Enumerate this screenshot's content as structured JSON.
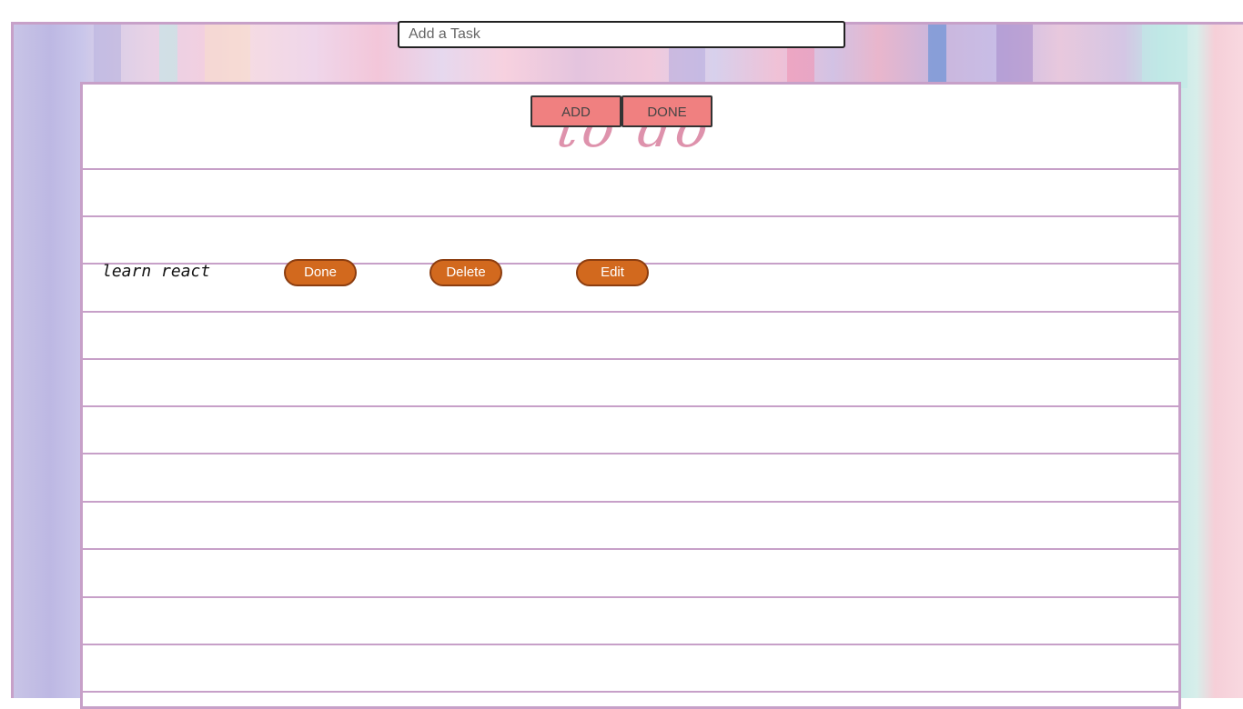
{
  "task_input": {
    "placeholder": "Add a Task",
    "value": ""
  },
  "toolbar": {
    "add_label": "ADD",
    "done_label": "DONE"
  },
  "title": "to do",
  "tasks": [
    {
      "text": "learn react",
      "done_label": "Done",
      "delete_label": "Delete",
      "edit_label": "Edit"
    }
  ],
  "colors": {
    "top_button": "#f08080",
    "action_button": "#d2691e",
    "rule_line": "#c7a0c8",
    "title_script": "#d9809e"
  }
}
